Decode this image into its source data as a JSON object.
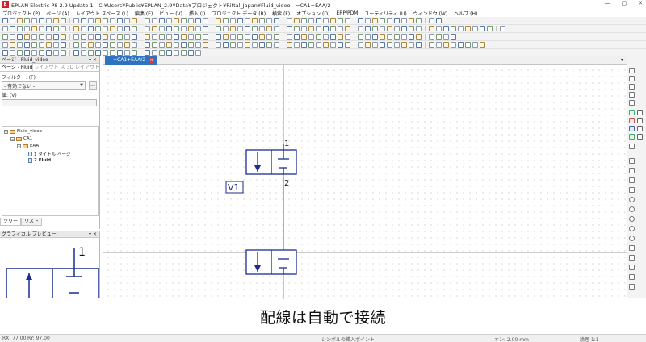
{
  "window": {
    "app_logo": "E",
    "title": "EPLAN Electric P8 2.9 Update 1 - C:¥Users¥Public¥EPLAN_2.9¥Data¥プロジェクト¥Rittal_Japan¥Fluid_video - =CA1+EAA/2",
    "minimize": "—",
    "maximize": "▢",
    "close": "✕"
  },
  "menu": [
    "プロジェクト (P)",
    "ページ (A)",
    "レイアウト スペース (L)",
    "編集 (E)",
    "ビュー (V)",
    "挿入 (I)",
    "プロジェクト データ (R)",
    "検索 (F)",
    "オプション (O)",
    "ERP/PDM",
    "ユーティリティ (U)",
    "ウィンドウ (W)",
    "ヘルプ (H)"
  ],
  "page_panel": {
    "title": "ページ - Fluid_video",
    "pin": "▾ ✕",
    "tabs": [
      "ページ - Fluid...",
      "レイアウト ス...",
      "3D レイアウト..."
    ],
    "filter_label": "フィルター: (F)",
    "filter_value": "- 有効でない -",
    "dots": "...",
    "value_label": "値: (V)",
    "tree": {
      "project": "Fluid_video",
      "location": "CA1",
      "function": "EAA",
      "pages": [
        "1 タイトル ページ",
        "2 Fluid"
      ]
    },
    "bottom_tabs": [
      "ツリー",
      "リスト"
    ]
  },
  "preview_panel": {
    "title": "グラフィカル プレビュー",
    "pin": "▾ ✕",
    "terminal_label": "1"
  },
  "document": {
    "tab_label": "=CA1+EAA/2",
    "tab_close": "×",
    "dropdown": "▾"
  },
  "schematic": {
    "device_tag": "V1",
    "upper_terminal_top": "1",
    "upper_terminal_bottom": "2"
  },
  "subtitle": "配線は自動で接続",
  "status": {
    "rx": "RX: 77.00",
    "ry": "RY: 97.00",
    "mode": "シンボルの挿入ポイント",
    "grid": "オン: 2.00 mm",
    "scale": "論理 1:1"
  },
  "colors": {
    "tab_active": "#2d73c0",
    "schematic_blue": "#1b2d8f",
    "wire_red": "#c0392b"
  }
}
